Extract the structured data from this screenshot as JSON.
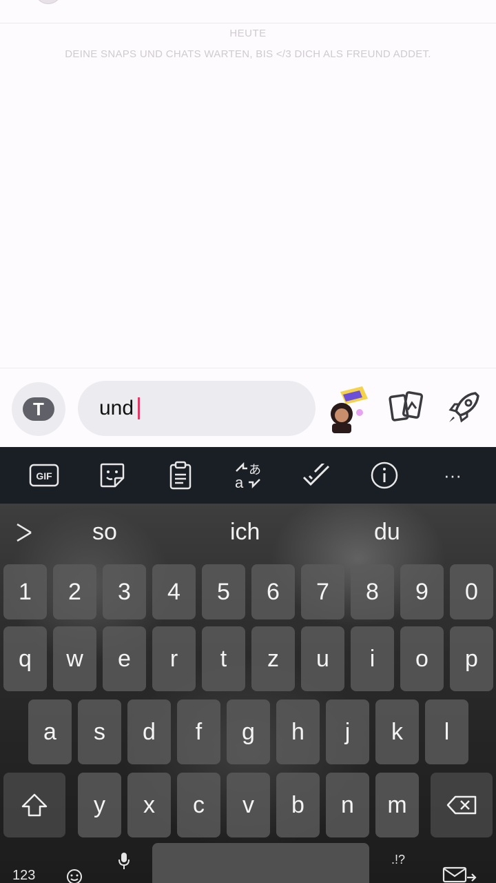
{
  "chat": {
    "day_label": "HEUTE",
    "info_text": "DEINE SNAPS UND CHATS WARTEN, BIS </3 DICH ALS FREUND ADDET."
  },
  "input_bar": {
    "text_tool_label": "T",
    "message_value": "und",
    "icons": [
      "text-tool-icon",
      "bitmoji-sticker-icon",
      "cards-icon",
      "rocket-icon"
    ]
  },
  "keyboard": {
    "toolbar_icons": [
      "gif-icon",
      "sticker-icon",
      "clipboard-icon",
      "translate-icon",
      "spellcheck-icon",
      "info-icon",
      "more-icon"
    ],
    "gif_label": "GIF",
    "more_label": "···",
    "suggestions": [
      "so",
      "ich",
      "du"
    ],
    "rows": {
      "numbers": [
        "1",
        "2",
        "3",
        "4",
        "5",
        "6",
        "7",
        "8",
        "9",
        "0"
      ],
      "row1": [
        "q",
        "w",
        "e",
        "r",
        "t",
        "z",
        "u",
        "i",
        "o",
        "p"
      ],
      "row2": [
        "a",
        "s",
        "d",
        "f",
        "g",
        "h",
        "j",
        "k",
        "l"
      ],
      "row3": [
        "y",
        "x",
        "c",
        "v",
        "b",
        "n",
        "m"
      ]
    },
    "bottom": {
      "num_switch": "123",
      "punct": ".!?"
    },
    "colors": {
      "toolbar_bg": "#1a1e25",
      "caret": "#e53966",
      "key_bg": "#5c5c5c"
    }
  }
}
